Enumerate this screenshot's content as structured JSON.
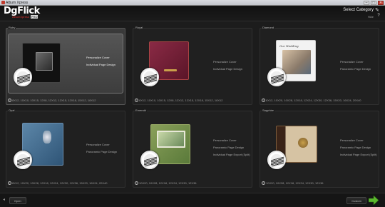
{
  "window": {
    "title": "Album Xpress"
  },
  "header": {
    "logo_main": "DgFlick",
    "logo_sub": "AlbumXpress",
    "logo_tag": "PRO",
    "select_category": "Select Category",
    "hide": "Hide"
  },
  "categories": [
    {
      "name": "Ruby",
      "features": [
        "Personalize Cover",
        "Individual Page Design"
      ],
      "sizes": "8X12, 10X10, 10X15, 12X8, 12X12, 12X15, 12X18, 15X12, 18X12"
    },
    {
      "name": "Royal",
      "features": [
        "Personalize Cover",
        "Individual Page Design"
      ],
      "sizes": "8X12, 10X10, 10X15, 12X8, 12X12, 12X15, 12X18, 15X12, 18X12"
    },
    {
      "name": "Diamond",
      "features": [
        "Personalize Cover",
        "Panoramic Page Design"
      ],
      "sizes": "8X12, 10X20, 10X28, 12X18, 12X24, 12X30, 12X36, 15X20, 16X24, 20X40"
    },
    {
      "name": "Opal",
      "features": [
        "Personalize Cover",
        "Panoramic Page Design"
      ],
      "sizes": "8X12, 10X20, 10X28, 12X18, 12X24, 12X30, 12X36, 15X20, 16X24, 20X40"
    },
    {
      "name": "Emerald",
      "features": [
        "Personalize Cover",
        "Panoramic Page Design",
        "Individual Page Export (Split)"
      ],
      "sizes": "10X20, 10X28, 12X18, 12X24, 12X30, 12X36"
    },
    {
      "name": "Sapphire",
      "features": [
        "Personalize Cover",
        "Panoramic Page Design",
        "Individual Page Export (Split)"
      ],
      "sizes": "10X20, 10X28, 12X18, 12X24, 12X30, 12X36"
    }
  ],
  "diamond_cover_text": "Our Wedding",
  "footer": {
    "open": "Open",
    "custom": "Custom"
  },
  "colors": {
    "accent": "#e0302c",
    "next_arrow": "#5cb82e",
    "background": "#1c1c1c"
  }
}
